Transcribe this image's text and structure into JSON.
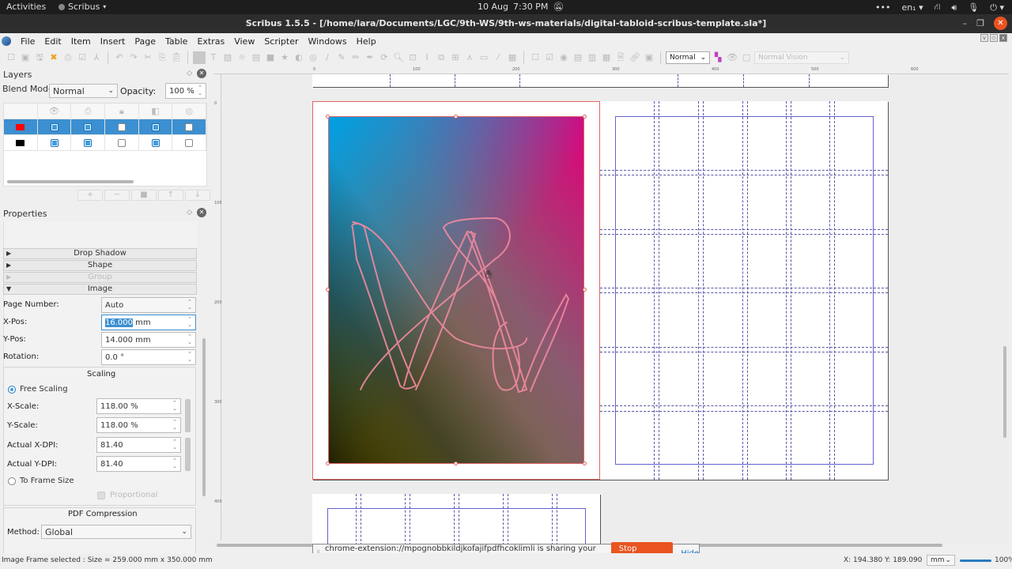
{
  "topbar": {
    "activities": "Activities",
    "app_name": "Scribus",
    "date": "10 Aug",
    "time": "7:30 PM",
    "lang": "en₁"
  },
  "window": {
    "title": "Scribus 1.5.5 - [/home/lara/Documents/LGC/9th-WS/9th-ws-materials/digital-tabloid-scribus-template.sla*]"
  },
  "menu": {
    "items": [
      "File",
      "Edit",
      "Item",
      "Insert",
      "Page",
      "Table",
      "Extras",
      "View",
      "Scripter",
      "Windows",
      "Help"
    ]
  },
  "toolbar": {
    "mode_select": "Normal",
    "vision_select": "Normal Vision"
  },
  "layers": {
    "title": "Layers",
    "blend_label": "Blend Mode:",
    "blend_value": "Normal",
    "opacity_label": "Opacity:",
    "opacity_value": "100 %",
    "rows": [
      {
        "color": "#ff0000",
        "visible": true,
        "printable": true,
        "locked": false,
        "flow": true,
        "outline": false,
        "selected": true
      },
      {
        "color": "#000000",
        "visible": true,
        "printable": true,
        "locked": false,
        "flow": true,
        "outline": false,
        "selected": false
      }
    ],
    "buttons": [
      "+",
      "−",
      "■",
      "↑",
      "↓"
    ]
  },
  "properties": {
    "title": "Properties",
    "sections": {
      "drop_shadow": "Drop Shadow",
      "shape": "Shape",
      "group": "Group",
      "image": "Image"
    },
    "page_number_label": "Page Number:",
    "page_number_value": "Auto",
    "xpos_label": "X-Pos:",
    "xpos_value_selected": "16.000",
    "xpos_unit": " mm",
    "ypos_label": "Y-Pos:",
    "ypos_value": "14.000 mm",
    "rotation_label": "Rotation:",
    "rotation_value": "0.0 °",
    "scaling": {
      "title": "Scaling",
      "free_scaling": "Free Scaling",
      "free_scaling_selected": true,
      "xscale_label": "X-Scale:",
      "xscale_value": "118.00 %",
      "yscale_label": "Y-Scale:",
      "yscale_value": "118.00 %",
      "xdpi_label": "Actual X-DPI:",
      "xdpi_value": "81.40",
      "ydpi_label": "Actual Y-DPI:",
      "ydpi_value": "81.40",
      "to_frame": "To Frame Size",
      "proportional": "Proportional"
    },
    "pdf": {
      "title": "PDF Compression",
      "method_label": "Method:",
      "method_value": "Global"
    }
  },
  "rulers": {
    "h_labels": [
      "0",
      "100",
      "200",
      "300",
      "400",
      "500",
      "600"
    ],
    "v_labels": [
      "0",
      "100",
      "200",
      "300",
      "400"
    ]
  },
  "status": {
    "left": "Image Frame selected : Size = 259.000 mm x 350.000 mm",
    "x": "X: 194.380",
    "y": "Y: 189.090",
    "unit": "mm",
    "zoom": "100%",
    "zoom_fraction": 1.0
  },
  "share_bar": {
    "message": "chrome-extension://mpognobbkildjkofajifpdfhcoklimli is sharing your screen.",
    "stop": "Stop sharing",
    "hide": "Hide"
  },
  "colors": {
    "accent": "#3c8fd0",
    "share_stop": "#e95420",
    "frame_selection": "#e06565",
    "guides": "#5557a8"
  }
}
